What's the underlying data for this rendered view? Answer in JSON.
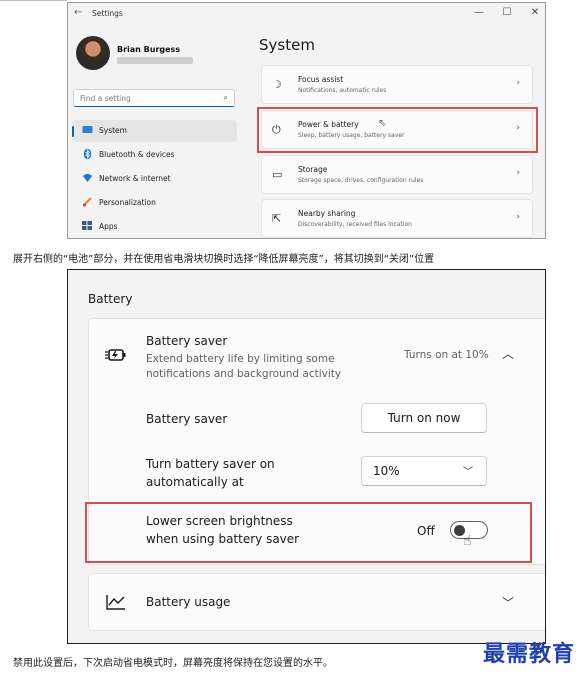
{
  "window": {
    "title": "Settings",
    "controls": [
      "—",
      "☐",
      "✕"
    ]
  },
  "user": {
    "name": "Brian Burgess"
  },
  "search": {
    "placeholder": "Find a setting"
  },
  "sidebar": {
    "items": [
      {
        "label": "System",
        "icon": "system-icon",
        "selected": true
      },
      {
        "label": "Bluetooth & devices",
        "icon": "bluetooth-icon"
      },
      {
        "label": "Network & internet",
        "icon": "network-icon"
      },
      {
        "label": "Personalization",
        "icon": "brush-icon"
      },
      {
        "label": "Apps",
        "icon": "apps-icon"
      }
    ]
  },
  "system": {
    "title": "System",
    "cards": [
      {
        "title": "Focus assist",
        "subtitle": "Notifications, automatic rules",
        "icon": "focus-assist-icon"
      },
      {
        "title": "Power & battery",
        "subtitle": "Sleep, battery usage, battery saver",
        "icon": "power-icon"
      },
      {
        "title": "Storage",
        "subtitle": "Storage space, drives, configuration rules",
        "icon": "storage-icon"
      },
      {
        "title": "Nearby sharing",
        "subtitle": "Discoverability, received files location",
        "icon": "share-icon"
      }
    ]
  },
  "captions": {
    "top": "展开右侧的“电池”部分，并在使用省电滑块切换时选择“降低屏幕亮度”，将其切换到“关闭”位置",
    "bottom": "禁用此设置后，下次启动省电模式时，屏幕亮度将保持在您设置的水平。"
  },
  "battery": {
    "heading": "Battery",
    "saver": {
      "title": "Battery saver",
      "desc_line1": "Extend battery life by limiting some",
      "desc_line2": "notifications and background activity",
      "status": "Turns on at 10%"
    },
    "saver_row": {
      "label": "Battery saver",
      "button": "Turn on now"
    },
    "auto_row": {
      "label_line1": "Turn battery saver on",
      "label_line2": "automatically at",
      "value": "10%"
    },
    "brightness_row": {
      "label_line1": "Lower screen brightness",
      "label_line2": "when using battery saver",
      "state": "Off"
    },
    "usage_row": {
      "label": "Battery usage"
    }
  },
  "watermark": "最需教育"
}
